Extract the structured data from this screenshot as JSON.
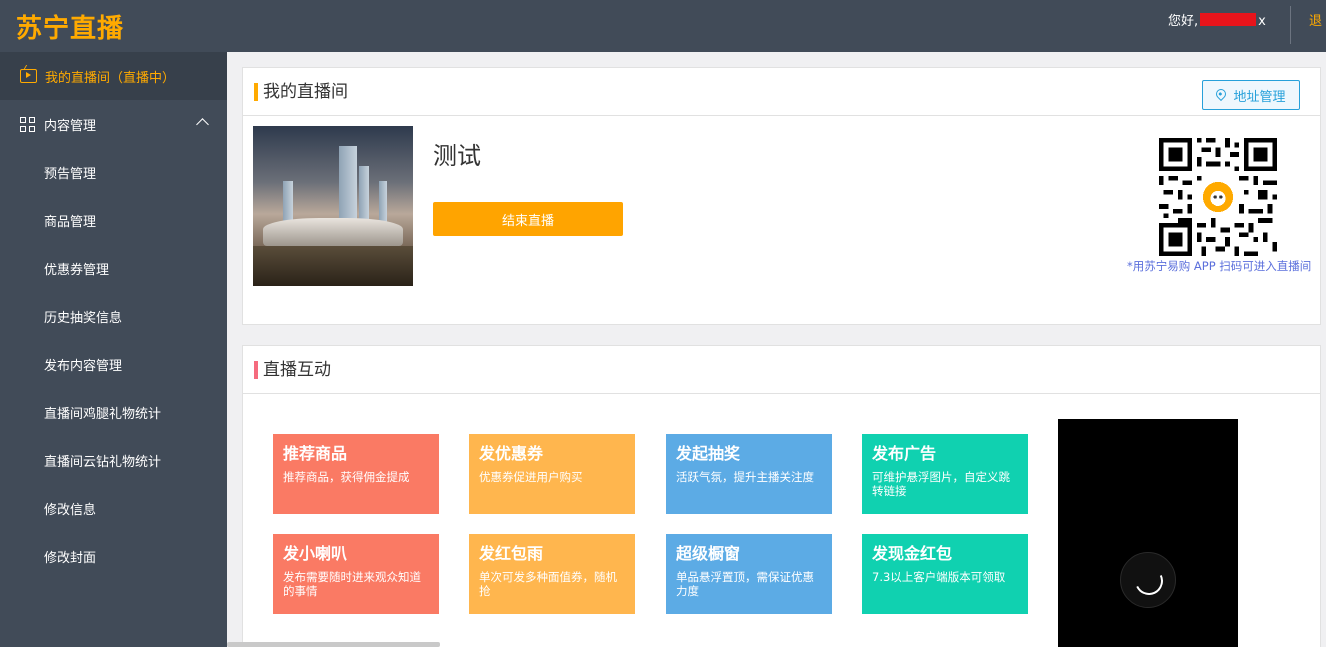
{
  "header": {
    "logo": "苏宁直播",
    "greeting_prefix": "您好,",
    "greeting_suffix": "x",
    "logout": "退"
  },
  "sidebar": {
    "active": "我的直播间（直播中）",
    "group": "内容管理",
    "items": [
      "预告管理",
      "商品管理",
      "优惠券管理",
      "历史抽奖信息",
      "发布内容管理",
      "直播间鸡腿礼物统计",
      "直播间云钻礼物统计",
      "修改信息",
      "修改封面"
    ]
  },
  "my_room": {
    "title": "我的直播间",
    "address_button": "地址管理",
    "room_name": "测试",
    "end_button": "结束直播",
    "qr_hint": "*用苏宁易购 APP 扫码可进入直播间"
  },
  "interaction": {
    "title": "直播互动",
    "tiles": [
      {
        "title": "推荐商品",
        "desc": "推荐商品，获得佣金提成"
      },
      {
        "title": "发优惠券",
        "desc": "优惠券促进用户购买"
      },
      {
        "title": "发起抽奖",
        "desc": "活跃气氛，提升主播关注度"
      },
      {
        "title": "发布广告",
        "desc": "可维护悬浮图片，自定义跳转链接"
      },
      {
        "title": "发小喇叭",
        "desc": "发布需要随时进来观众知道的事情"
      },
      {
        "title": "发红包雨",
        "desc": "单次可发多种面值券，随机抢"
      },
      {
        "title": "超级橱窗",
        "desc": "单品悬浮置顶，需保证优惠力度"
      },
      {
        "title": "发现金红包",
        "desc": "7.3以上客户端版本可领取"
      }
    ]
  },
  "colors": {
    "accent": "#ffaa00",
    "sidebar_bg": "#414b58",
    "tile_red": "#fa7a64",
    "tile_orange": "#ffb64e",
    "tile_blue": "#5cabe5",
    "tile_green": "#10d1b0"
  },
  "icons": {
    "active": "tv-icon",
    "group": "grid-icon",
    "address": "location-pin-icon",
    "video": "loading-spinner-icon"
  }
}
